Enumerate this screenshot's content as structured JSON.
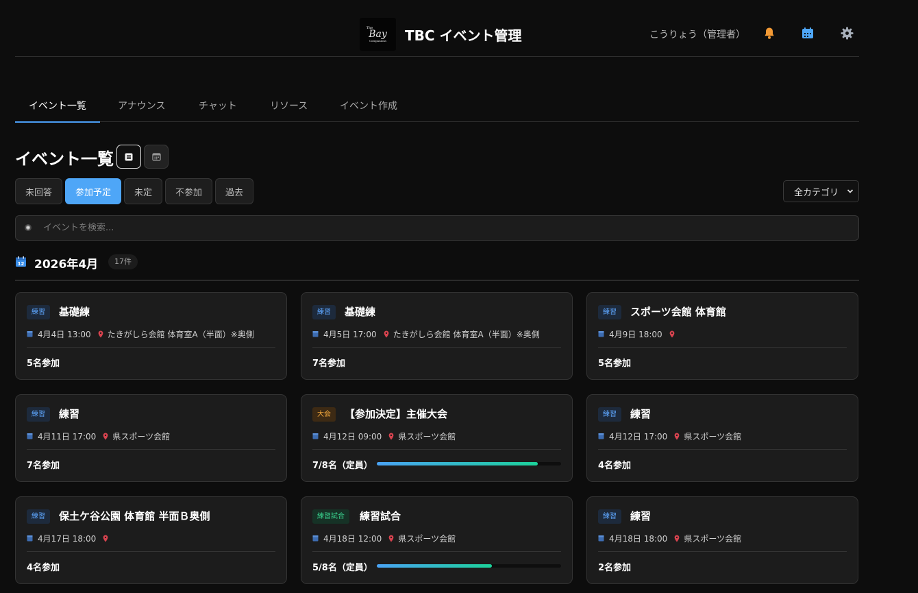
{
  "header": {
    "logo_text": [
      "The",
      "Bay",
      "Companions"
    ],
    "app_title": "TBC イベント管理",
    "user_name": "こうりょう（管理者）",
    "icons": [
      "bell-icon",
      "calendar-icon",
      "gear-icon"
    ]
  },
  "tabs": [
    {
      "label": "イベント一覧",
      "active": true
    },
    {
      "label": "アナウンス",
      "active": false
    },
    {
      "label": "チャット",
      "active": false
    },
    {
      "label": "リソース",
      "active": false
    },
    {
      "label": "イベント作成",
      "active": false
    }
  ],
  "section": {
    "title": "イベント一覧",
    "view_modes": [
      "list",
      "calendar"
    ]
  },
  "filters": [
    {
      "label": "未回答",
      "active": false
    },
    {
      "label": "参加予定",
      "active": true
    },
    {
      "label": "未定",
      "active": false
    },
    {
      "label": "不参加",
      "active": false
    },
    {
      "label": "過去",
      "active": false
    }
  ],
  "category_select": {
    "value": "全カテゴリ"
  },
  "search": {
    "placeholder": "イベントを検索..."
  },
  "month": {
    "title": "2026年4月",
    "count": "17件"
  },
  "colors": {
    "accent": "#4ea6f7",
    "practice": "#5ea7ff",
    "tournament": "#f0a63b",
    "match": "#39d08d",
    "pin": "#d8434f",
    "bell": "#f39a35"
  },
  "cards": [
    {
      "badge": "練習",
      "type": "practice",
      "title": "基礎練",
      "datetime": "4月4日 13:00",
      "location": "たきがしら会館 体育室A（半面）※奥側",
      "footer": "5名参加"
    },
    {
      "badge": "練習",
      "type": "practice",
      "title": "基礎練",
      "datetime": "4月5日 17:00",
      "location": "たきがしら会館 体育室A（半面）※奥側",
      "footer": "7名参加"
    },
    {
      "badge": "練習",
      "type": "practice",
      "title": "スポーツ会館 体育館",
      "datetime": "4月9日 18:00",
      "location": "",
      "footer": "5名参加"
    },
    {
      "badge": "練習",
      "type": "practice",
      "title": "練習",
      "datetime": "4月11日 17:00",
      "location": "県スポーツ会館",
      "footer": "7名参加"
    },
    {
      "badge": "大会",
      "type": "tournament",
      "title": "【参加決定】主催大会",
      "datetime": "4月12日 09:00",
      "location": "県スポーツ会館",
      "footer": "7/8名（定員）",
      "progress": 0.875
    },
    {
      "badge": "練習",
      "type": "practice",
      "title": "練習",
      "datetime": "4月12日 17:00",
      "location": "県スポーツ会館",
      "footer": "4名参加"
    },
    {
      "badge": "練習",
      "type": "practice",
      "title": "保土ケ谷公園 体育館 半面Ｂ奥側",
      "datetime": "4月17日 18:00",
      "location": "",
      "footer": "4名参加"
    },
    {
      "badge": "練習試合",
      "type": "match",
      "title": "練習試合",
      "datetime": "4月18日 12:00",
      "location": "県スポーツ会館",
      "footer": "5/8名（定員）",
      "progress": 0.625
    },
    {
      "badge": "練習",
      "type": "practice",
      "title": "練習",
      "datetime": "4月18日 18:00",
      "location": "県スポーツ会館",
      "footer": "2名参加"
    }
  ]
}
